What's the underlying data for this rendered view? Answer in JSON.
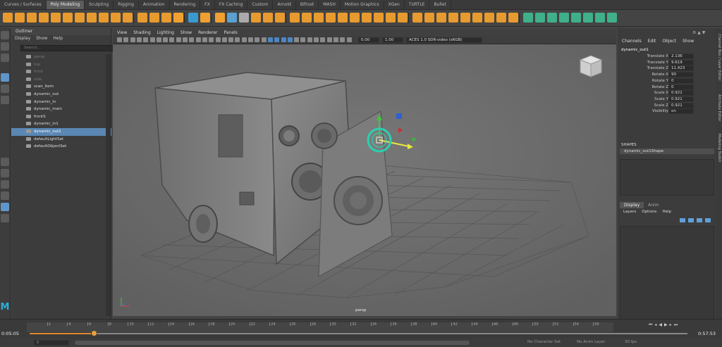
{
  "shelf": {
    "tabs": [
      "Curves / Surfaces",
      "Poly Modeling",
      "Sculpting",
      "Rigging",
      "Animation",
      "Rendering",
      "FX",
      "FX Caching",
      "Custom",
      "Arnold",
      "Bifrost",
      "MASH",
      "Motion Graphics",
      "XGen",
      "TURTLE",
      "Bullet"
    ],
    "active_tab": "Poly Modeling"
  },
  "outliner": {
    "title": "Outliner",
    "menu": [
      "Display",
      "Show",
      "Help"
    ],
    "search_placeholder": "Search...",
    "items": [
      {
        "label": "persp",
        "dim": true,
        "selected": false
      },
      {
        "label": "top",
        "dim": true,
        "selected": false
      },
      {
        "label": "front",
        "dim": true,
        "selected": false
      },
      {
        "label": "side",
        "dim": true,
        "selected": false
      },
      {
        "label": "scan_item",
        "dim": false,
        "selected": false
      },
      {
        "label": "dynamic_out",
        "dim": false,
        "selected": false
      },
      {
        "label": "dynamic_in",
        "dim": false,
        "selected": false
      },
      {
        "label": "dynamic_main",
        "dim": false,
        "selected": false
      },
      {
        "label": "frontS",
        "dim": false,
        "selected": false
      },
      {
        "label": "dynamic_in1",
        "dim": false,
        "selected": false
      },
      {
        "label": "dynamic_out1",
        "dim": false,
        "selected": true
      },
      {
        "label": "defaultLightSet",
        "dim": false,
        "selected": false
      },
      {
        "label": "defaultObjectSet",
        "dim": false,
        "selected": false
      }
    ]
  },
  "viewport": {
    "menu": [
      "View",
      "Shading",
      "Lighting",
      "Show",
      "Renderer",
      "Panels"
    ],
    "field1": "0.00",
    "field2": "1.00",
    "colorspace": "ACES 1.0 SDR-video (sRGB)",
    "camera_label": "persp"
  },
  "channel_box": {
    "menu": [
      "Channels",
      "Edit",
      "Object",
      "Show"
    ],
    "object_name": "dynamic_out1",
    "attributes": [
      {
        "name": "Translate X",
        "value": "2.136"
      },
      {
        "name": "Translate Y",
        "value": "9.619"
      },
      {
        "name": "Translate Z",
        "value": "11.423"
      },
      {
        "name": "Rotate X",
        "value": "90"
      },
      {
        "name": "Rotate Y",
        "value": "0"
      },
      {
        "name": "Rotate Z",
        "value": "0"
      },
      {
        "name": "Scale X",
        "value": "0.921"
      },
      {
        "name": "Scale Y",
        "value": "0.921"
      },
      {
        "name": "Scale Z",
        "value": "0.921"
      },
      {
        "name": "Visibility",
        "value": "on"
      }
    ],
    "shapes_header": "SHAPES",
    "shape_name": "dynamic_out1Shape"
  },
  "layer_editor": {
    "tabs": [
      "Display",
      "Anim"
    ],
    "active_tab": "Display",
    "menu": [
      "Layers",
      "Options",
      "Help"
    ]
  },
  "side_tabs": [
    "Channel Box / Layer Editor",
    "Attribute Editor",
    "Modeling Toolkit"
  ],
  "timeline": {
    "current_time": "0:05:05",
    "end_time": "0:57:53",
    "progress": 0.097,
    "ticks": [
      "2",
      "4",
      "6",
      "8",
      "10",
      "12",
      "14",
      "16",
      "18",
      "20",
      "22",
      "24",
      "26",
      "28",
      "30",
      "32",
      "34",
      "36",
      "38",
      "40",
      "42",
      "44",
      "46",
      "48",
      "50",
      "52",
      "54",
      "56"
    ]
  },
  "range_bar": {
    "start": "0",
    "character_set": "No Character Set",
    "anim_layer": "No Anim Layer",
    "fps": "30 fps"
  },
  "logo": "M"
}
